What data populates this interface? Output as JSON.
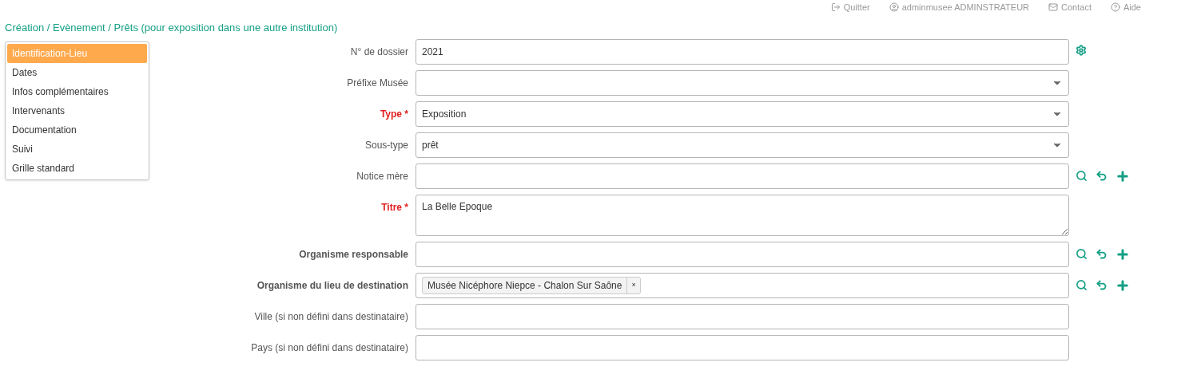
{
  "top_links": [
    {
      "kind": "logout",
      "label": "Quitter"
    },
    {
      "kind": "user",
      "label": "adminmusee ADMINSTRATEUR"
    },
    {
      "kind": "mail",
      "label": "Contact"
    },
    {
      "kind": "help",
      "label": "Aide"
    }
  ],
  "breadcrumb": "Création / Evènement / Prêts (pour exposition dans une autre institution)",
  "sidebar": {
    "items": [
      {
        "label": "Identification-Lieu",
        "selected": true
      },
      {
        "label": "Dates",
        "selected": false
      },
      {
        "label": "Infos complémentaires",
        "selected": false
      },
      {
        "label": "Intervenants",
        "selected": false
      },
      {
        "label": "Documentation",
        "selected": false
      },
      {
        "label": "Suivi",
        "selected": false
      },
      {
        "label": "Grille standard",
        "selected": false
      }
    ]
  },
  "fields": [
    {
      "label": "N° de dossier",
      "kind": "input",
      "value": "2021",
      "required": false,
      "bold": false,
      "actions": [
        {
          "kind": "gear"
        }
      ]
    },
    {
      "label": "Préfixe Musée",
      "kind": "select",
      "required": false,
      "bold": false
    },
    {
      "label": "Type *",
      "kind": "select",
      "value": "Exposition",
      "required": true,
      "bold": true
    },
    {
      "label": "Sous-type",
      "kind": "select",
      "value": "prêt",
      "required": false,
      "bold": false
    },
    {
      "label": "Notice mère",
      "kind": "input",
      "required": false,
      "bold": false,
      "actions": [
        {
          "kind": "search"
        },
        {
          "kind": "undo"
        },
        {
          "kind": "add"
        }
      ]
    },
    {
      "label": "Titre *",
      "kind": "textarea",
      "value": "La Belle Epoque",
      "required": true,
      "bold": true
    },
    {
      "label": "Organisme responsable",
      "kind": "input",
      "required": false,
      "bold": true,
      "actions": [
        {
          "kind": "search"
        },
        {
          "kind": "undo"
        },
        {
          "kind": "add"
        }
      ]
    },
    {
      "label": "Organisme du lieu de destination",
      "kind": "tags",
      "tags": [
        {
          "label": "Musée Nicéphore Niepce - Chalon Sur Saône",
          "remove": "×"
        }
      ],
      "required": false,
      "bold": true,
      "actions": [
        {
          "kind": "search"
        },
        {
          "kind": "undo"
        },
        {
          "kind": "add"
        }
      ]
    },
    {
      "label": "Ville (si non défini dans destinataire)",
      "kind": "input",
      "required": false,
      "bold": false
    },
    {
      "label": "Pays (si non défini dans destinataire)",
      "kind": "input",
      "required": false,
      "bold": false
    }
  ]
}
